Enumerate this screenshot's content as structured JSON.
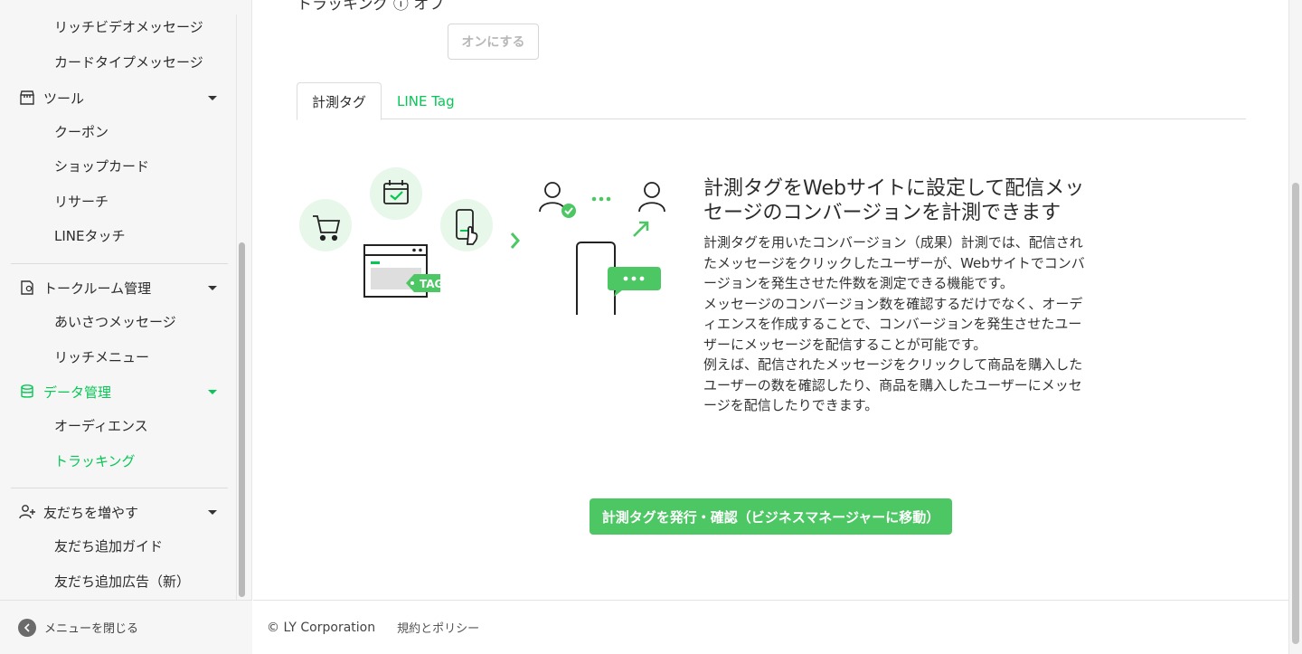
{
  "sidebar": {
    "items_top": [
      {
        "label": "リッチビデオメッセージ"
      },
      {
        "label": "カードタイプメッセージ"
      }
    ],
    "tools": {
      "label": "ツール",
      "items": [
        "クーポン",
        "ショップカード",
        "リサーチ",
        "LINEタッチ"
      ]
    },
    "talkroom": {
      "label": "トークルーム管理",
      "items": [
        "あいさつメッセージ",
        "リッチメニュー"
      ]
    },
    "data": {
      "label": "データ管理",
      "items": [
        "オーディエンス",
        "トラッキング"
      ]
    },
    "friends": {
      "label": "友だちを増やす",
      "items": [
        "友だち追加ガイド",
        "友だち追加広告（新）"
      ]
    },
    "close_label": "メニューを閉じる"
  },
  "main": {
    "top_cut_label": "トラッキング ⓘ  オフ",
    "on_button": "オンにする",
    "tabs": [
      {
        "label": "計測タグ"
      },
      {
        "label": "LINE Tag"
      }
    ],
    "illustration": {
      "tag_label": "TAG"
    },
    "title": "計測タグをWebサイトに設定して配信メッセージのコンバージョンを計測できます",
    "description": "計測タグを用いたコンバージョン（成果）計測では、配信されたメッセージをクリックしたユーザーが、Webサイトでコンバージョンを発生させた件数を測定できる機能です。\nメッセージのコンバージョン数を確認するだけでなく、オーディエンスを作成することで、コンバージョンを発生させたユーザーにメッセージを配信することが可能です。\n例えば、配信されたメッセージをクリックして商品を購入したユーザーの数を確認したり、商品を購入したユーザーにメッセージを配信したりできます。",
    "issue_button": "計測タグを発行・確認（ビジネスマネージャーに移動）"
  },
  "footer": {
    "copyright": "© LY Corporation",
    "policy": "規約とポリシー"
  },
  "colors": {
    "accent": "#06c755",
    "button_green": "#4cc764"
  }
}
